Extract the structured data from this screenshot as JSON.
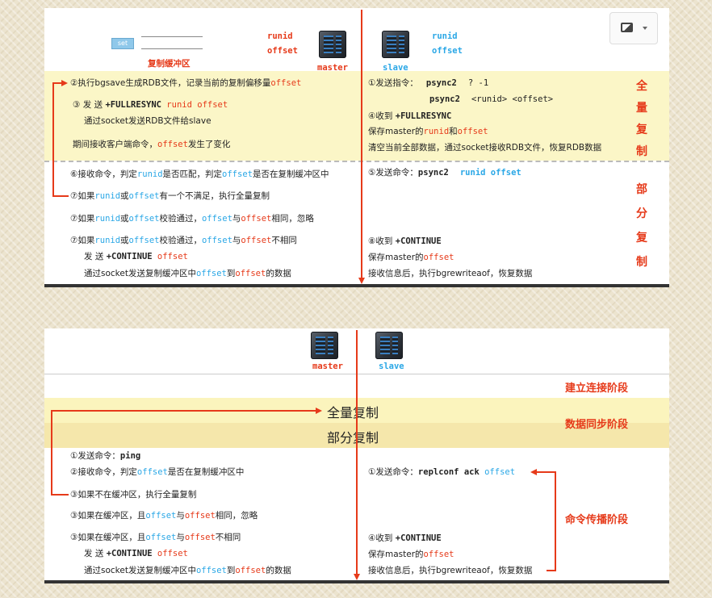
{
  "top": {
    "set_label": "set",
    "buffer_label": "复制缓冲区",
    "master_runid": "runid",
    "master_offset": "offset",
    "master_label": "master",
    "slave_runid": "runid",
    "slave_offset": "offset",
    "slave_label": "slave",
    "image_icon": "image-icon",
    "full": {
      "side_label": [
        "全",
        "量",
        "复",
        "制"
      ],
      "left": {
        "s2_a": "②执行bgsave生成RDB文件，记录当前的复制偏移量",
        "s2_b": "offset",
        "s3_a": "③ 发 送 ",
        "s3_b": "+FULLRESYNC",
        "s3_c": " runid",
        "s3_d": " offset",
        "s3_e": "通过socket发送RDB文件给slave",
        "s3_f": "期间接收客户端命令，",
        "s3_g": "offset",
        "s3_h": "发生了变化"
      },
      "right": {
        "s1_a": "①发送指令：",
        "s1_b": "psync2",
        "s1_c": "? -1",
        "s1_d": "psync2",
        "s1_e": "<runid> <offset>",
        "s4_a": "④收到 ",
        "s4_b": "+FULLRESYNC",
        "s4_c": "保存master的",
        "s4_d": "runid",
        "s4_e": "和",
        "s4_f": "offset",
        "s4_g": "清空当前全部数据，通过socket接收RDB文件，恢复RDB数据"
      }
    },
    "partial": {
      "side_label": [
        "部",
        "分",
        "复",
        "制"
      ],
      "left": {
        "s6_a": "⑥接收命令，判定",
        "s6_b": "runid",
        "s6_c": "是否匹配，判定",
        "s6_d": "offset",
        "s6_e": "是否在复制缓冲区中",
        "s7a_a": "⑦如果",
        "s7a_b": "runid",
        "s7a_c": "或",
        "s7a_d": "offset",
        "s7a_e": "有一个不满足，执行全量复制",
        "s7b_a": "⑦如果",
        "s7b_b": "runid",
        "s7b_c": "或",
        "s7b_d": "offset",
        "s7b_e": "校验通过，",
        "s7b_f": "offset",
        "s7b_g": "与",
        "s7b_h": "offset",
        "s7b_i": "相同，忽略",
        "s7c_a": "⑦如果",
        "s7c_b": "runid",
        "s7c_c": "或",
        "s7c_d": "offset",
        "s7c_e": "校验通过，",
        "s7c_f": "offset",
        "s7c_g": "与",
        "s7c_h": "offset",
        "s7c_i": "不相同",
        "s7c_j": "发 送 ",
        "s7c_k": "+CONTINUE",
        "s7c_l": " offset",
        "s7c_m": "通过socket发送复制缓冲区中",
        "s7c_n": "offset",
        "s7c_o": "到",
        "s7c_p": "offset",
        "s7c_q": "的数据"
      },
      "right": {
        "s5_a": "⑤发送命令：",
        "s5_b": "psync2",
        "s5_c": "runid offset",
        "s8_a": "⑧收到 ",
        "s8_b": "+CONTINUE",
        "s8_c": "保存master的",
        "s8_d": "offset",
        "s8_e": "接收信息后，执行bgrewriteaof，恢复数据"
      }
    }
  },
  "bottom": {
    "master_label": "master",
    "slave_label": "slave",
    "phase_connect": "建立连接阶段",
    "full_copy": "全量复制",
    "partial_copy": "部分复制",
    "phase_sync": "数据同步阶段",
    "phase_propagate": "命令传播阶段",
    "left": {
      "p1_a": "①发送命令：",
      "p1_b": "ping",
      "p2_a": "②接收命令，判定",
      "p2_b": "offset",
      "p2_c": "是否在复制缓冲区中",
      "p3a": "③如果不在缓冲区，执行全量复制",
      "p3b_a": "③如果在缓冲区，且",
      "p3b_b": "offset",
      "p3b_c": "与",
      "p3b_d": "offset",
      "p3b_e": "相同，忽略",
      "p3c_a": "③如果在缓冲区，且",
      "p3c_b": "offset",
      "p3c_c": "与",
      "p3c_d": "offset",
      "p3c_e": "不相同",
      "p3c_f": "发 送 ",
      "p3c_g": "+CONTINUE",
      "p3c_h": " offset",
      "p3c_i": "通过socket发送复制缓冲区中",
      "p3c_j": "offset",
      "p3c_k": "到",
      "p3c_l": "offset",
      "p3c_m": "的数据"
    },
    "right": {
      "q1_a": "①发送命令：",
      "q1_b": "replconf ack",
      "q1_c": " offset",
      "q4_a": "④收到 ",
      "q4_b": "+CONTINUE",
      "q4_c": "保存master的",
      "q4_d": "offset",
      "q4_e": "接收信息后，执行bgrewriteaof，恢复数据"
    }
  }
}
